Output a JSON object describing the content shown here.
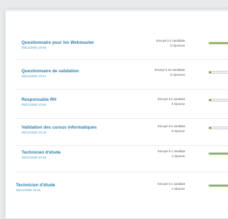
{
  "rows": [
    {
      "title": "Questionnaire pour les Webmaster",
      "date": "09/11/2008 10:56",
      "sent": "Envoyé à 2 candidats",
      "responses": "0 réponses",
      "progress": 1.0
    },
    {
      "title": "Questionnaire de validation",
      "date": "09/11/2008 10:51",
      "sent": "Envoyé à 10 candidats",
      "responses": "0 réponses",
      "progress": 0.08
    },
    {
      "title": "Responsable RH",
      "date": "09/11/2008 10:50",
      "sent": "Envoyé à 5 candidat",
      "responses": "0 réponse",
      "progress": 0.08
    },
    {
      "title": "Validation des cursus informatiques",
      "date": "09/11/2008 10:49",
      "sent": "Envoyé à 5 candidat",
      "responses": "0 réponse",
      "progress": 0.08
    },
    {
      "title": "Technicien d'étude",
      "date": "09/11/2008 10:45",
      "sent": "Envoyé à 1 candidat",
      "responses": "1 réponse",
      "progress": 1.0
    },
    {
      "title": "Technicien d'étude",
      "date": "09/11/2008 10:40",
      "sent": "Envoyé à 1 candidat",
      "responses": "1 réponse",
      "progress": 1.0
    }
  ],
  "colors": {
    "accent": "#2d7fb0",
    "progress": "#86b93a"
  }
}
